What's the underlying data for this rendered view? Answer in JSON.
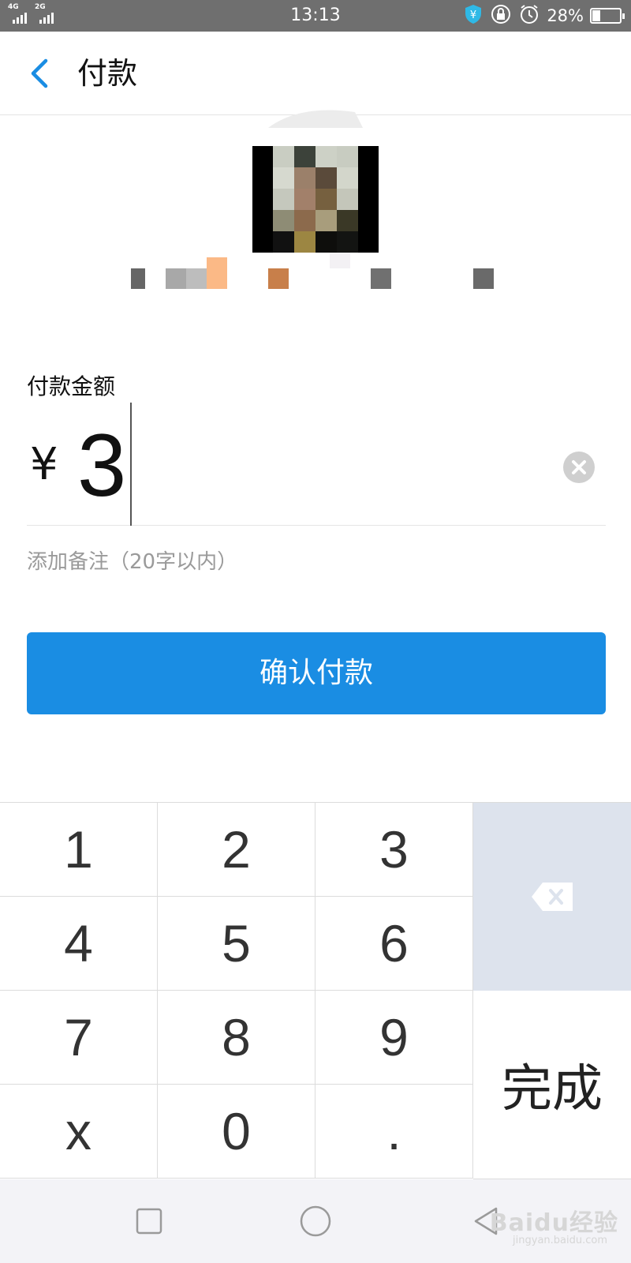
{
  "status_bar": {
    "signal_1_label": "4G",
    "signal_2_label": "2G",
    "time": "13:13",
    "battery_percent": "28%",
    "battery_level": 0.28,
    "icons": [
      "shield-yuan-icon",
      "lock-rotation-icon",
      "alarm-icon",
      "battery-icon"
    ]
  },
  "nav": {
    "title": "付款",
    "back_icon": "chevron-left-icon"
  },
  "payee": {
    "avatar": "pixelated-avatar",
    "name": "pixelated-name"
  },
  "amount": {
    "label": "付款金额",
    "currency_symbol": "¥",
    "value": "3",
    "clear_icon": "clear-icon"
  },
  "note": {
    "placeholder": "添加备注（20字以内）"
  },
  "confirm_button": {
    "label": "确认付款"
  },
  "keypad": {
    "keys": [
      "1",
      "2",
      "3",
      "4",
      "5",
      "6",
      "7",
      "8",
      "9",
      "x",
      "0",
      "."
    ],
    "backspace_icon": "backspace-icon",
    "done_label": "完成"
  },
  "system_nav": {
    "icons": [
      "recent-apps-icon",
      "home-icon",
      "back-icon"
    ]
  },
  "watermark": {
    "text": "Baidu经验",
    "sub": "jingyan.baidu.com"
  },
  "colors": {
    "accent": "#1a8de3",
    "status_bar": "#6f6f6f",
    "backspace_key_bg": "#dde3ed"
  }
}
